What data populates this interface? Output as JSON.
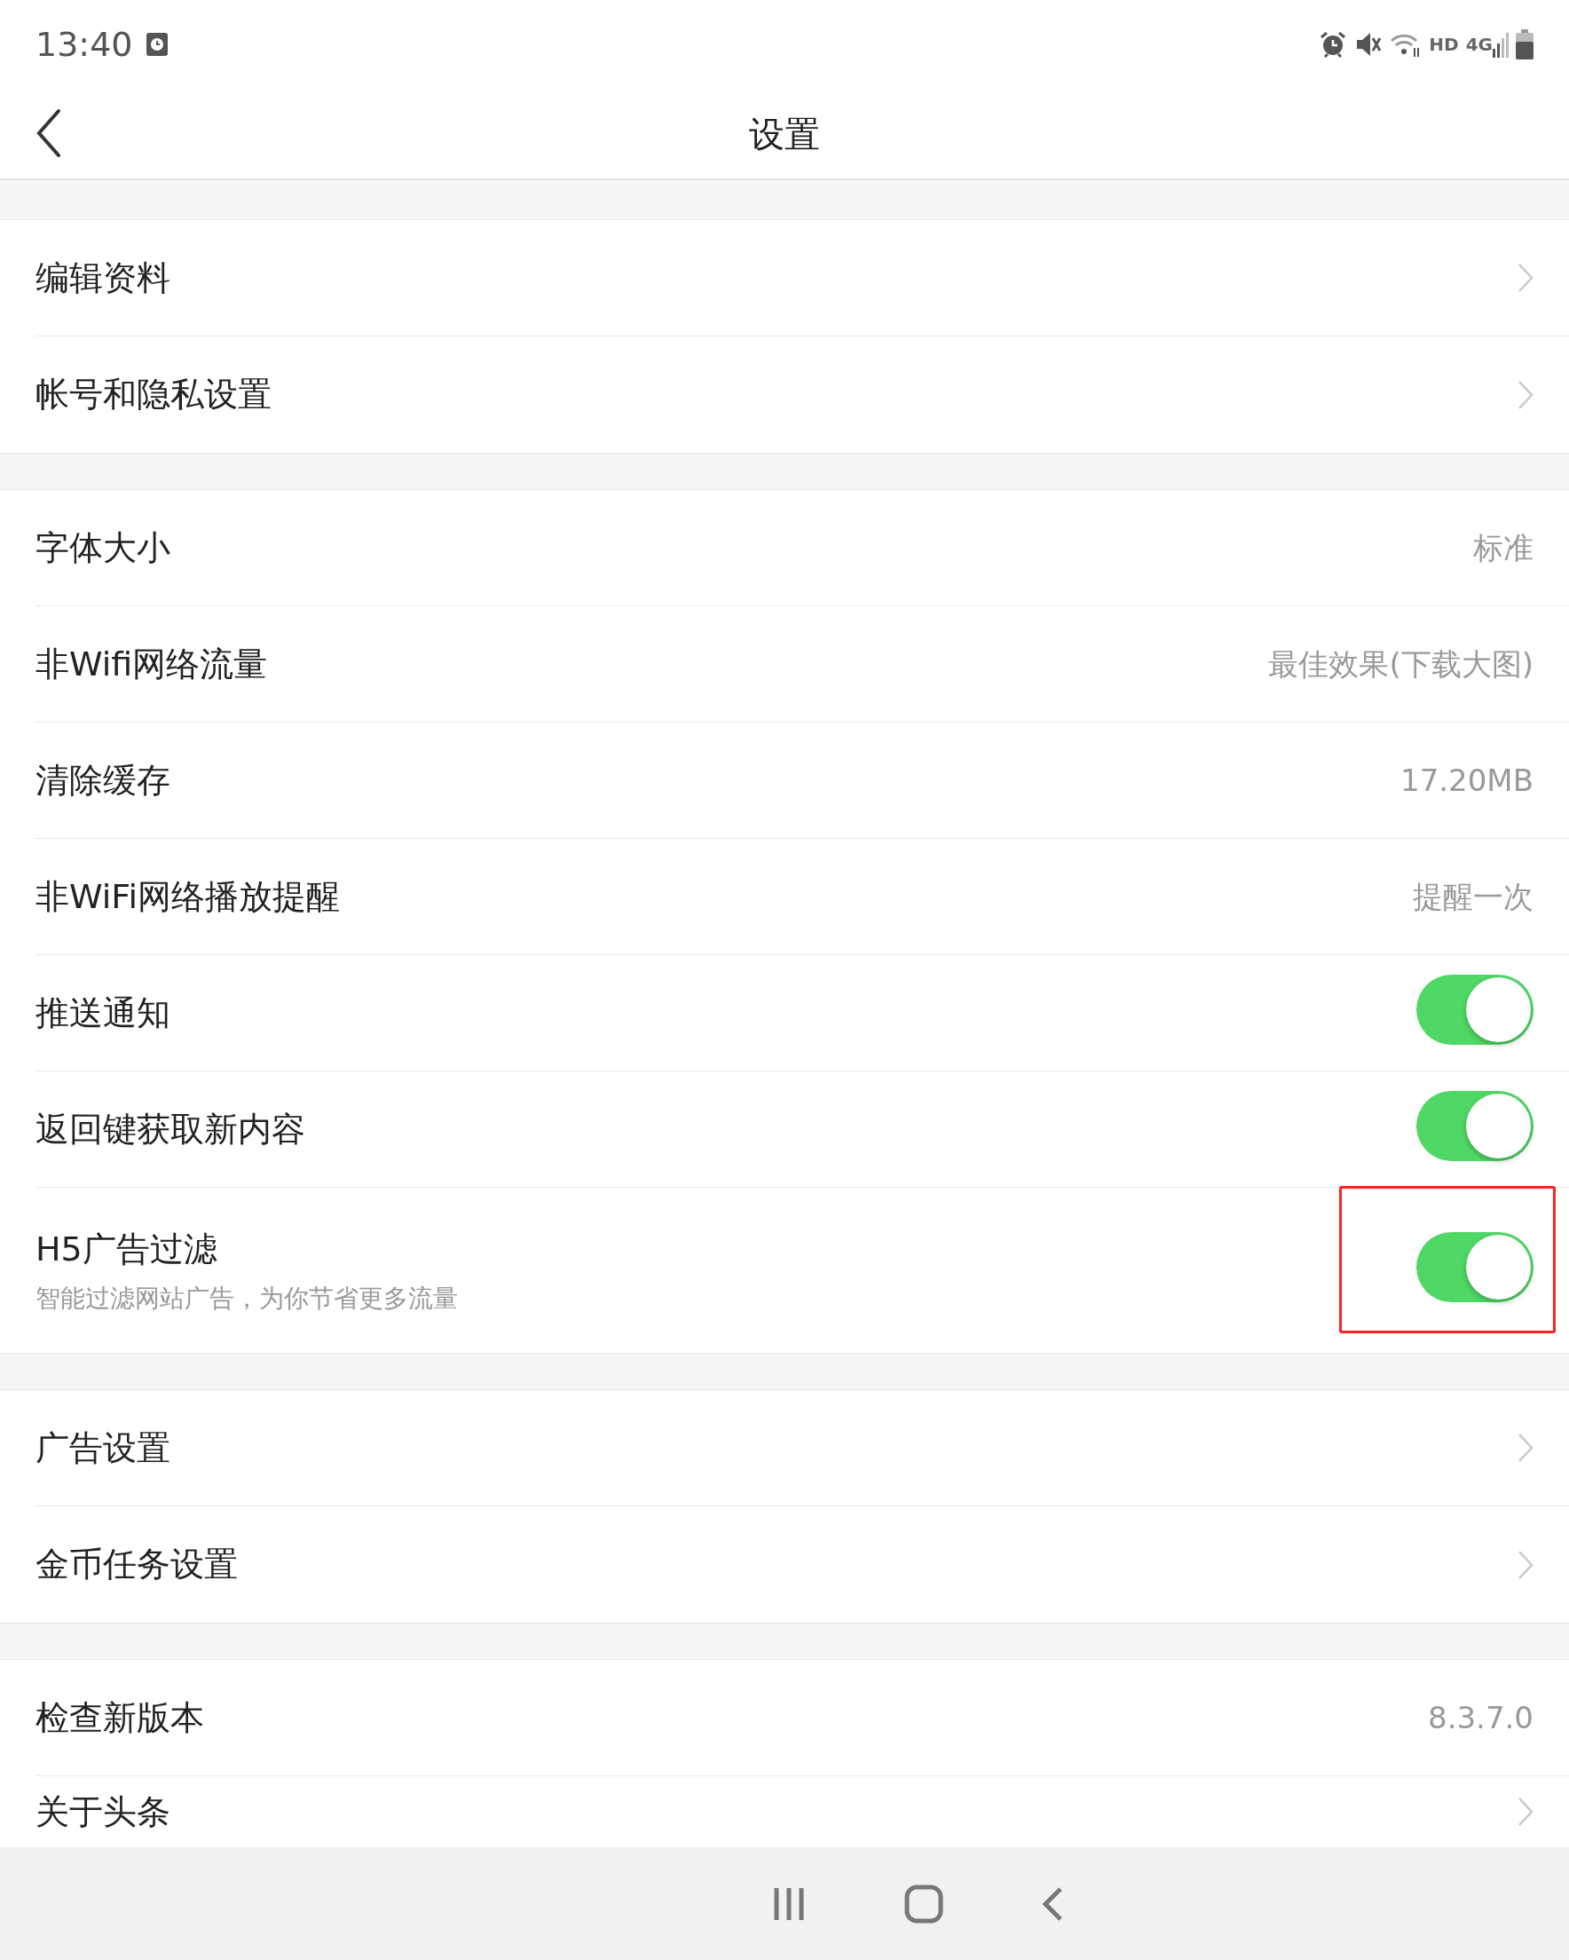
{
  "status_bar": {
    "time": "13:40",
    "hd": "HD",
    "network": "4G"
  },
  "header": {
    "title": "设置"
  },
  "groups": [
    {
      "items": [
        {
          "kind": "link",
          "label": "编辑资料"
        },
        {
          "kind": "link",
          "label": "帐号和隐私设置"
        }
      ]
    },
    {
      "items": [
        {
          "kind": "value",
          "label": "字体大小",
          "value": "标准"
        },
        {
          "kind": "value",
          "label": "非Wifi网络流量",
          "value": "最佳效果(下载大图)"
        },
        {
          "kind": "value",
          "label": "清除缓存",
          "value": "17.20MB"
        },
        {
          "kind": "value",
          "label": "非WiFi网络播放提醒",
          "value": "提醒一次"
        },
        {
          "kind": "toggle",
          "label": "推送通知",
          "on": true,
          "highlighted": false
        },
        {
          "kind": "toggle",
          "label": "返回键获取新内容",
          "on": true,
          "highlighted": false
        },
        {
          "kind": "toggle",
          "label": "H5广告过滤",
          "subtitle": "智能过滤网站广告，为你节省更多流量",
          "on": true,
          "highlighted": true
        }
      ]
    },
    {
      "items": [
        {
          "kind": "link",
          "label": "广告设置"
        },
        {
          "kind": "link",
          "label": "金币任务设置"
        }
      ]
    },
    {
      "items": [
        {
          "kind": "value",
          "label": "检查新版本",
          "value": "8.3.7.0"
        },
        {
          "kind": "link",
          "label": "关于头条"
        }
      ]
    }
  ]
}
